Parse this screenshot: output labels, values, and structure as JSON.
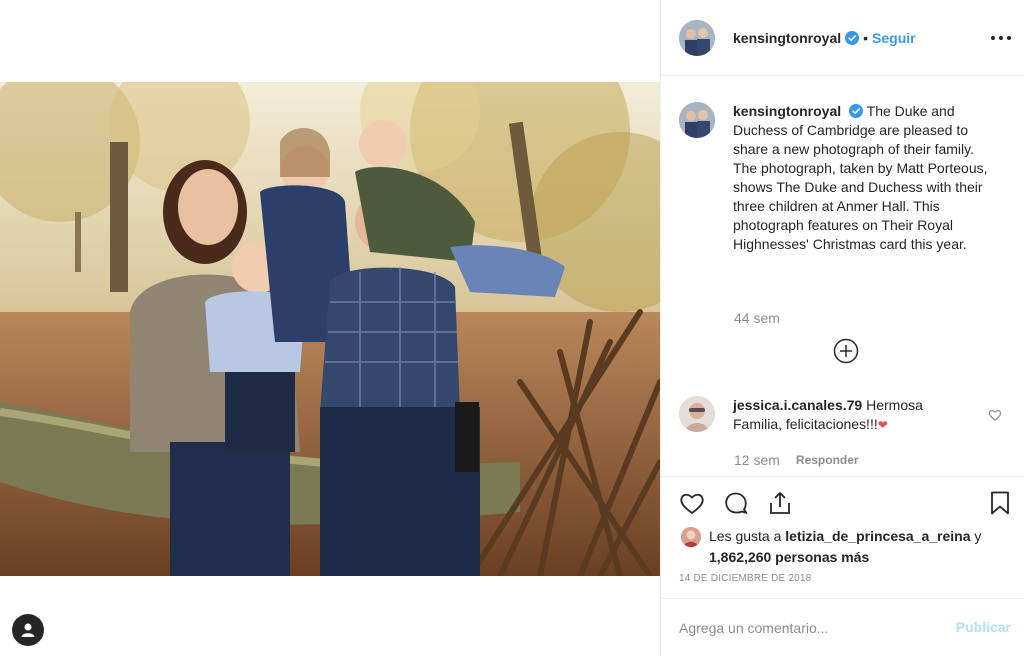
{
  "post": {
    "username": "kensingtonroyal",
    "separator": "•",
    "follow_label": "Seguir",
    "caption": "The Duke and Duchess of Cambridge are pleased to share a new photograph of their family.\nThe photograph, taken by Matt Porteous, shows The Duke and Duchess with their three children at Anmer Hall. This photograph features on Their Royal Highnesses' Christmas card this year.",
    "caption_time": "44 sem",
    "date": "14 DE DICIEMBRE DE 2018"
  },
  "comments": [
    {
      "username": "jessica.i.canales.79",
      "text": "Hermosa Familia, felicitaciones!!!",
      "emoji": "❤",
      "time": "12 sem",
      "reply_label": "Responder"
    }
  ],
  "likes": {
    "prefix": "Les gusta a",
    "liker": "letizia_de_princesa_a_reina",
    "joiner": "y",
    "count_text": "1,862,260 personas más"
  },
  "comment_box": {
    "placeholder": "Agrega un comentario...",
    "publish_label": "Publicar"
  },
  "icons": {
    "verified": "verified-badge-icon",
    "more": "more-options-icon",
    "load_more": "plus-circle-icon",
    "like": "heart-icon",
    "comment": "comment-icon",
    "share": "share-icon",
    "save": "bookmark-icon",
    "user": "user-icon"
  },
  "colors": {
    "link": "#3897f0",
    "muted": "#8e8e8e",
    "publish_disabled": "#b2dffc",
    "text": "#262626"
  }
}
